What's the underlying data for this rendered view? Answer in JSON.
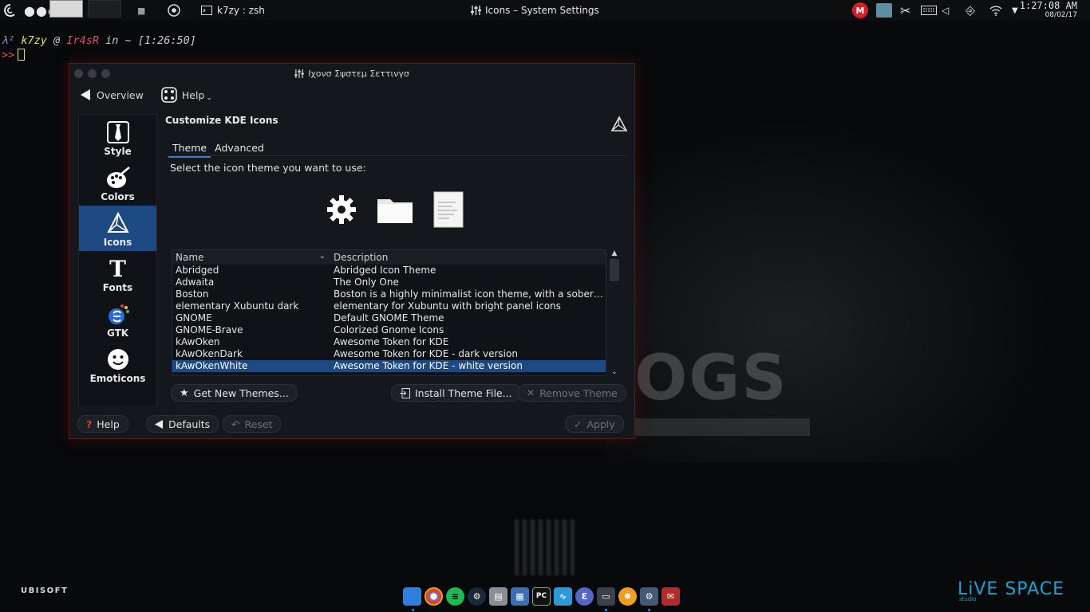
{
  "top_panel": {
    "task_title": "k7zy : zsh",
    "window_title": "Icons – System Settings",
    "clock_time": "1:27:08 AM",
    "clock_date": "08/02/17",
    "tray_m_label": "M"
  },
  "terminal": {
    "lambda": "λ²",
    "user": "k7zy",
    "at": "@",
    "host": "Ir4sR",
    "in_path": "in ~",
    "time": "[1:26:50]",
    "prompt": ">>"
  },
  "window": {
    "title": "Ιχονσ  Σψστεμ Σεττινγσ",
    "toolbar": {
      "overview": "Overview",
      "help": "Help"
    },
    "sidebar": [
      {
        "label": "Style",
        "icon": "tie-icon"
      },
      {
        "label": "Colors",
        "icon": "palette-icon"
      },
      {
        "label": "Icons",
        "icon": "kde-icons-icon",
        "active": true
      },
      {
        "label": "Fonts",
        "icon": "font-icon"
      },
      {
        "label": "GTK",
        "icon": "gtk-icon"
      },
      {
        "label": "Emoticons",
        "icon": "smiley-icon"
      }
    ],
    "page_title": "Customize KDE Icons",
    "tabs": [
      {
        "label": "Theme",
        "active": true
      },
      {
        "label": "Advanced",
        "active": false
      }
    ],
    "instruction": "Select the icon theme you want to use:",
    "list": {
      "columns": {
        "name": "Name",
        "description": "Description"
      },
      "rows": [
        {
          "name": "Abridged",
          "description": "Abridged Icon Theme"
        },
        {
          "name": "Adwaita",
          "description": "The Only One"
        },
        {
          "name": "Boston",
          "description": "Boston is a highly minimalist icon theme, with a sober col..."
        },
        {
          "name": "elementary Xubuntu dark",
          "description": "elementary for Xubuntu with bright panel icons"
        },
        {
          "name": "GNOME",
          "description": "Default GNOME Theme"
        },
        {
          "name": "GNOME-Brave",
          "description": "Colorized Gnome Icons"
        },
        {
          "name": "kAwOken",
          "description": "Awesome Token for KDE"
        },
        {
          "name": "kAwOkenDark",
          "description": "Awesome Token for KDE - dark version"
        },
        {
          "name": "kAwOkenWhite",
          "description": "Awesome Token for KDE - white version",
          "selected": true
        }
      ]
    },
    "buttons": {
      "get_new": "Get New Themes...",
      "install": "Install Theme File...",
      "remove": "Remove Theme",
      "help": "Help",
      "defaults": "Defaults",
      "reset": "Reset",
      "apply": "Apply"
    }
  },
  "desktop": {
    "ubisoft": "UBISOFT",
    "live_space": "LiVE SPACE",
    "live_space_sub": "studio"
  },
  "colors": {
    "accent": "#1d4a82",
    "window_bg": "#14181d",
    "border_glow": "#5a1820"
  }
}
